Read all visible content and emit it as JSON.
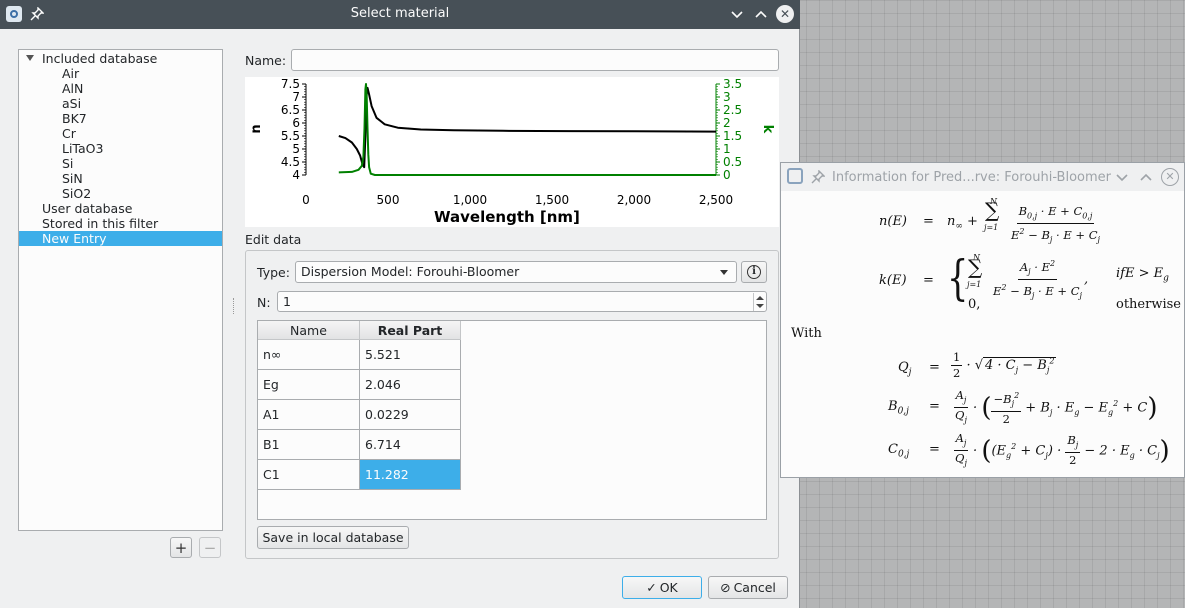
{
  "dialog": {
    "title": "Select material",
    "tree": {
      "group_included": "Included database",
      "items": [
        "Air",
        "AlN",
        "aSi",
        "BK7",
        "Cr",
        "LiTaO3",
        "Si",
        "SiN",
        "SiO2"
      ],
      "user_database": "User database",
      "stored_filter": "Stored in this filter",
      "new_entry": "New Entry"
    },
    "add_label": "+",
    "remove_label": "−",
    "name_label": "Name:",
    "name_value": "",
    "edit_data_label": "Edit data",
    "type_label": "Type:",
    "type_value": "Dispersion Model: Forouhi-Bloomer",
    "n_label": "N:",
    "n_value": "1",
    "table": {
      "headers": [
        "Name",
        "Real Part"
      ],
      "rows": [
        {
          "name": "n∞",
          "value": "5.521"
        },
        {
          "name": "Eg",
          "value": "2.046"
        },
        {
          "name": "A1",
          "value": "0.0229"
        },
        {
          "name": "B1",
          "value": "6.714"
        },
        {
          "name": "C1",
          "value": "11.282"
        }
      ]
    },
    "save_button": "Save in local database",
    "ok_button": "OK",
    "cancel_button": "Cancel"
  },
  "chart_data": {
    "type": "line",
    "xlabel": "Wavelength [nm]",
    "ylabel_left": "n",
    "ylabel_right": "k",
    "xlim": [
      0,
      2500
    ],
    "ylim_left": [
      4,
      7.5
    ],
    "ylim_right": [
      0,
      3.5
    ],
    "x_ticks": [
      "0",
      "500",
      "1,000",
      "1,500",
      "2,000",
      "2,500"
    ],
    "y_left_ticks": [
      "4",
      "4.5",
      "5",
      "5.5",
      "6",
      "6.5",
      "7",
      "7.5"
    ],
    "y_right_ticks": [
      "0",
      "0.5",
      "1",
      "1.5",
      "2",
      "2.5",
      "3",
      "3.5"
    ],
    "colors": {
      "n": "#000000",
      "k": "#008000"
    },
    "series": [
      {
        "axis": "left",
        "x": [
          200,
          240,
          280,
          310,
          330,
          345,
          355,
          362,
          368,
          375,
          385,
          400,
          430,
          480,
          560,
          700,
          900,
          1200,
          1600,
          2000,
          2500
        ],
        "values": [
          5.5,
          5.42,
          5.25,
          5.0,
          4.75,
          4.4,
          4.3,
          5.5,
          7.0,
          7.35,
          7.1,
          6.65,
          6.2,
          5.95,
          5.82,
          5.75,
          5.72,
          5.7,
          5.69,
          5.68,
          5.67
        ]
      },
      {
        "axis": "right",
        "x": [
          200,
          280,
          320,
          340,
          350,
          357,
          362,
          366,
          370,
          375,
          380,
          385,
          395,
          420,
          500,
          1000,
          2500
        ],
        "values": [
          0.1,
          0.12,
          0.2,
          0.35,
          0.7,
          1.8,
          3.3,
          3.5,
          3.0,
          1.8,
          0.8,
          0.3,
          0.05,
          0.0,
          0.0,
          0.0,
          0.0
        ]
      }
    ]
  },
  "info_window": {
    "title": "Information for Pred...rve: Forouhi-Bloomer",
    "with_label": "With",
    "otherwise_label": "otherwise",
    "condition_label": "ifE > E",
    "condition_sub": "g"
  }
}
